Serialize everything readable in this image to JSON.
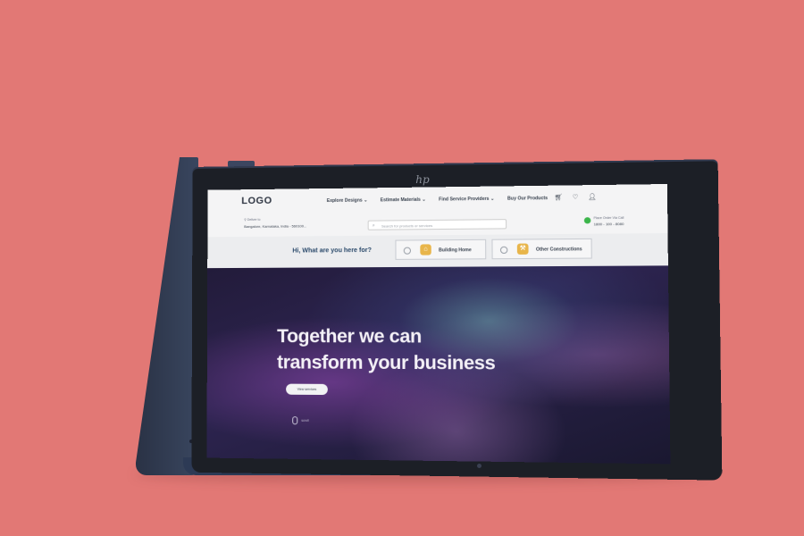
{
  "nav": {
    "logo": "LOGO",
    "links": [
      "Explore Designs ⌄",
      "Estimate Materials ⌄",
      "Find Service Providers ⌄",
      "Buy Our Products"
    ],
    "icons": [
      "cart-icon",
      "heart-icon",
      "user-icon"
    ]
  },
  "subbar": {
    "deliver_label": "Deliver to",
    "address": "Bangalore, Karnataka, India - 560100...",
    "search_placeholder": "Search for products or services",
    "call_label": "Place Order Via Call",
    "phone": "1800 - 100 - 8080"
  },
  "ask": {
    "title": "Hi, What are you here for?",
    "options": [
      {
        "label": "Building Home",
        "icon": "house-icon"
      },
      {
        "label": "Other Constructions",
        "icon": "crane-icon"
      }
    ]
  },
  "hero": {
    "headline_line1": "Together we can",
    "headline_line2": "transform your business",
    "cta": "View services",
    "scroll_hint": "scroll"
  },
  "device": {
    "brand_mark": "hp"
  },
  "colors": {
    "background": "#e27875",
    "device_body": "#2d3a55",
    "hero_text": "#f4f1f7",
    "accent_heading": "#2b4a6b"
  }
}
